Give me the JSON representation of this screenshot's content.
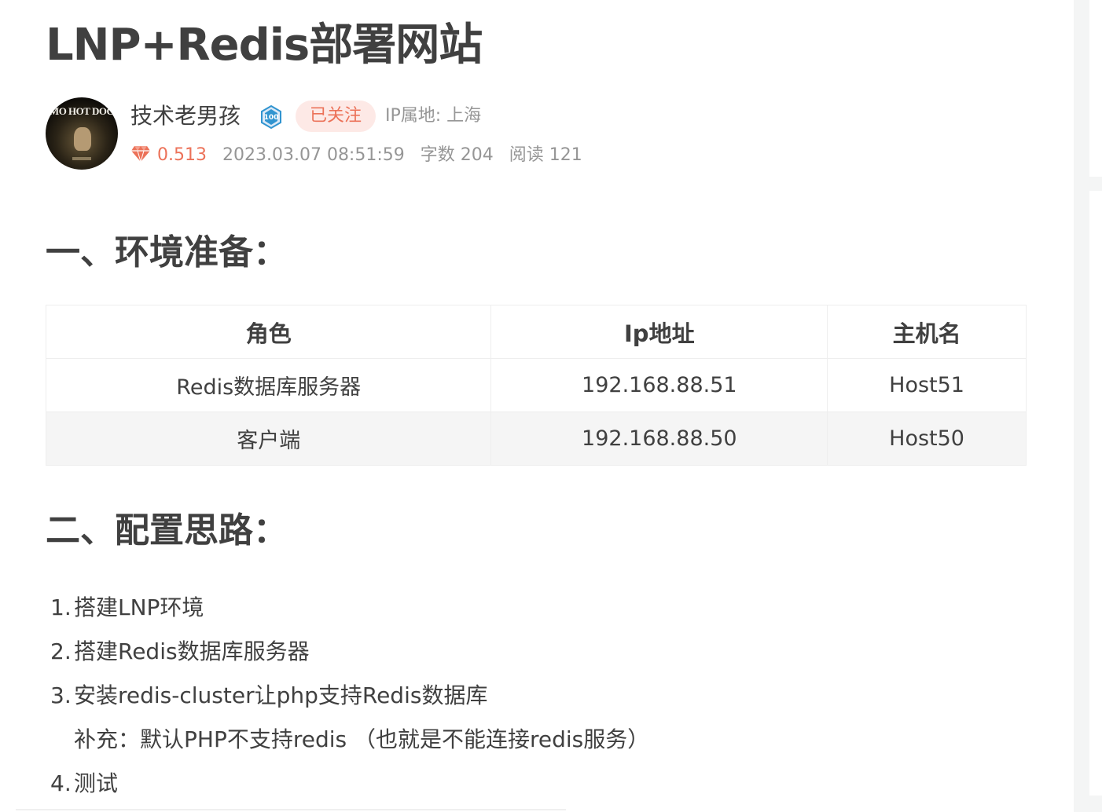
{
  "article": {
    "title": "LNP+Redis部署网站"
  },
  "author": {
    "name": "技术老男孩",
    "avatar_text": "MO HOT DOG",
    "level_badge": "100",
    "follow_label": "已关注",
    "ip_location": "IP属地: 上海",
    "diamond_value": "0.513",
    "datetime": "2023.03.07 08:51:59",
    "word_count": "字数 204",
    "read_count": "阅读 121"
  },
  "sections": [
    {
      "heading": "一、环境准备："
    },
    {
      "heading": "二、配置思路："
    }
  ],
  "table": {
    "headers": [
      "角色",
      "Ip地址",
      "主机名"
    ],
    "rows": [
      [
        "Redis数据库服务器",
        "192.168.88.51",
        "Host51"
      ],
      [
        "客户端",
        "192.168.88.50",
        "Host50"
      ]
    ]
  },
  "steps": [
    {
      "num": "1.",
      "text": "搭建LNP环境"
    },
    {
      "num": "2.",
      "text": "搭建Redis数据库服务器"
    },
    {
      "num": "3.",
      "text": "安装redis-cluster让php支持Redis数据库"
    },
    {
      "num": "",
      "text": "补充：默认PHP不支持redis （也就是不能连接redis服务）"
    },
    {
      "num": "4.",
      "text": "测试"
    }
  ],
  "colors": {
    "text": "#404040",
    "muted": "#969696",
    "accent": "#ec7259",
    "follow_bg": "#fde9e6",
    "badge_blue": "#3194d0"
  },
  "icons": {
    "diamond": "diamond-icon",
    "level": "level-badge-icon"
  }
}
